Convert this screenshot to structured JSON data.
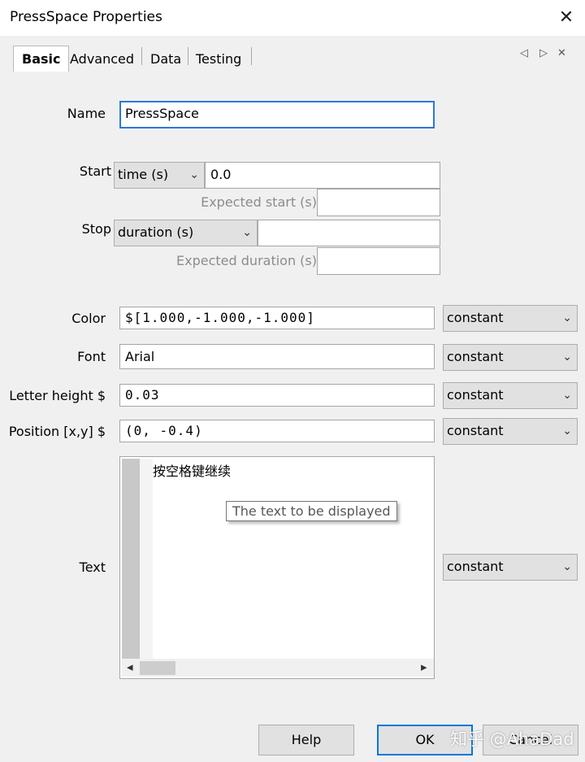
{
  "window": {
    "title": "PressSpace Properties",
    "close_glyph": "✕"
  },
  "tabs": [
    {
      "label": "Basic"
    },
    {
      "label": "Advanced"
    },
    {
      "label": "Data"
    },
    {
      "label": "Testing"
    }
  ],
  "tab_nav": {
    "prev_glyph": "◁",
    "next_glyph": "▷",
    "close_glyph": "✕"
  },
  "form": {
    "name": {
      "label": "Name",
      "value": "PressSpace"
    },
    "start": {
      "label": "Start",
      "type": "time (s)",
      "value": "0.0",
      "expected_label": "Expected start (s)",
      "expected_value": ""
    },
    "stop": {
      "label": "Stop",
      "type": "duration (s)",
      "value": "",
      "expected_label": "Expected duration (s)",
      "expected_value": ""
    },
    "color": {
      "label": "Color",
      "value": "$[1.000,-1.000,-1.000]",
      "update": "constant"
    },
    "font": {
      "label": "Font",
      "value": "Arial",
      "update": "constant"
    },
    "letter_height": {
      "label": "Letter height $",
      "value": "0.03",
      "update": "constant"
    },
    "position": {
      "label": "Position [x,y] $",
      "value": "(0, -0.4)",
      "update": "constant"
    },
    "text": {
      "label": "Text",
      "value": "按空格键继续",
      "tooltip": "The text to be displayed",
      "update": "constant"
    }
  },
  "buttons": {
    "help": "Help",
    "ok": "OK",
    "cancel": "Cancel"
  },
  "watermark": "知乎 @AhaDad",
  "icons": {
    "chevron": "chevron-down-icon",
    "scroll_left": "◂",
    "scroll_right": "▸"
  }
}
